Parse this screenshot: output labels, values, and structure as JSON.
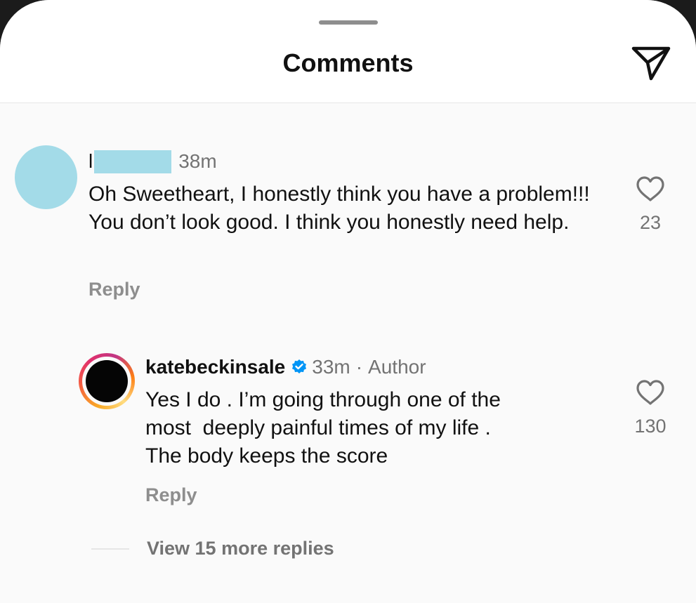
{
  "header": {
    "title": "Comments",
    "share_icon": "paper-plane-icon"
  },
  "comments": [
    {
      "username_visible": "l",
      "username_redacted": true,
      "time": "38m",
      "text": "Oh Sweetheart, I honestly think you have a problem!!! You don’t look good. I think you honestly need help.",
      "likes": "23",
      "reply_label": "Reply",
      "avatar_color": "#a3dbe8"
    },
    {
      "username": "katebeckinsale",
      "verified": true,
      "time": "33m",
      "separator": "·",
      "author_tag": "Author",
      "text_lines": [
        "Yes I do . I’m going through one of the",
        "most  deeply painful times of my life .",
        "The body keeps the score"
      ],
      "likes": "130",
      "reply_label": "Reply"
    }
  ],
  "view_more": {
    "label": "View 15 more replies"
  },
  "colors": {
    "verified_badge": "#0095f6",
    "muted_text": "#737373",
    "reply_text": "#8e8e8e"
  }
}
